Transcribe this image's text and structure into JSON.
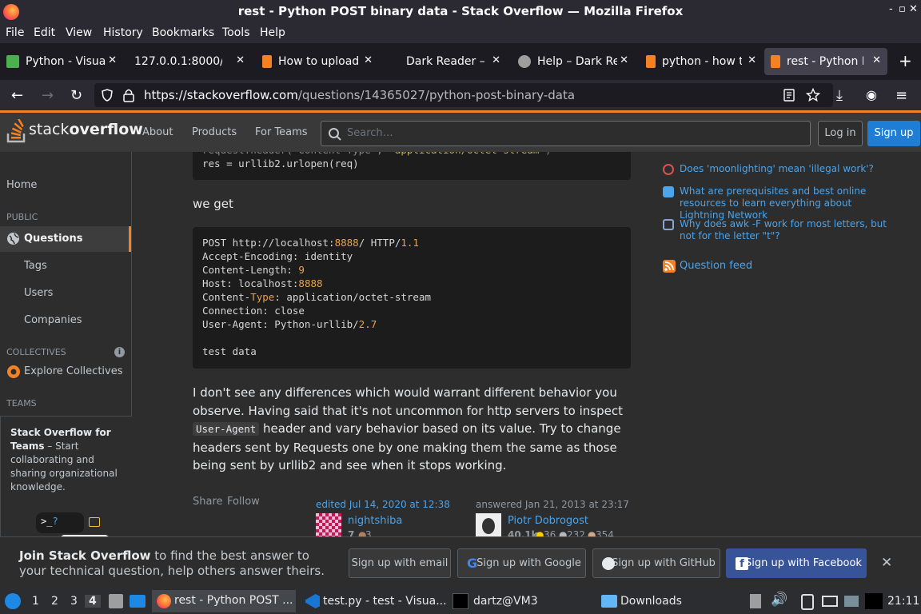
{
  "window": {
    "title": "rest - Python POST binary data - Stack Overflow — Mozilla Firefox",
    "controls": [
      "-",
      "▫",
      "✕"
    ]
  },
  "menu": [
    "File",
    "Edit",
    "View",
    "History",
    "Bookmarks",
    "Tools",
    "Help"
  ],
  "tabs": [
    {
      "label": "Python - Visual",
      "fav": "#4caf50",
      "close": "✕"
    },
    {
      "label": "127.0.0.1:8000/",
      "fav": "",
      "close": "✕"
    },
    {
      "label": "How to upload",
      "fav": "#f48225",
      "close": "✕"
    },
    {
      "label": "Dark Reader –",
      "fav": "",
      "close": "✕"
    },
    {
      "label": "Help – Dark Re",
      "fav": "#9e9e9e",
      "close": "✕"
    },
    {
      "label": "python - how t",
      "fav": "#f48225",
      "close": "✕"
    },
    {
      "label": "rest - Python P",
      "fav": "#f48225",
      "close": "✕"
    }
  ],
  "nav": {
    "url_host": "https://stackoverflow.com",
    "url_path": "/questions/14365027/python-post-binary-data"
  },
  "so": {
    "logo_a": "stack",
    "logo_b": "overflow",
    "nav": [
      "About",
      "Products",
      "For Teams"
    ],
    "search_placeholder": "Search…",
    "login": "Log in",
    "signup": "Sign up"
  },
  "leftnav": {
    "home": "Home",
    "public": "PUBLIC",
    "questions": "Questions",
    "tags": "Tags",
    "users": "Users",
    "companies": "Companies",
    "collectives": "COLLECTIVES",
    "explore": "Explore Collectives",
    "teams": "TEAMS",
    "teams_title": "Stack Overflow for Teams",
    "teams_desc": " – Start collaborating and sharing organizational knowledge."
  },
  "code1": {
    "line1": "res = urllib2.urlopen(req)"
  },
  "we_get": "we get",
  "code2": {
    "l1a": "POST http://localhost:",
    "l1b": "8888",
    "l1c": "/ HTTP/",
    "l1d": "1.1",
    "l2": "Accept-Encoding: identity",
    "l3a": "Content-Length: ",
    "l3b": "9",
    "l4a": "Host: localhost:",
    "l4b": "8888",
    "l5a": "Content-",
    "l5b": "Type",
    "l5c": ": application/octet-stream",
    "l6": "Connection: close",
    "l7a": "User-Agent: Python-urllib/",
    "l7b": "2.7",
    "l8": "test data"
  },
  "answer": {
    "p1": "I don't see any differences which would warrant different behavior you observe. Having said that it's not uncommon for http servers to inspect ",
    "code": "User-Agent",
    "p2": " header and vary behavior based on its value. Try to change headers sent by Requests one by one making them the same as those being sent by urllib2 and see when it stops working.",
    "share": "Share",
    "follow": "Follow",
    "edited": "edited Jul 14, 2020 at 12:38",
    "editor": "nightshiba",
    "editor_rep": "7",
    "editor_bronze": "3",
    "answered": "answered Jan 21, 2013 at 23:17",
    "author": "Piotr Dobrogost",
    "author_rep": "40.1k",
    "gold": "36",
    "silver": "232",
    "bronze": "354"
  },
  "hot": [
    "Does 'moonlighting' mean 'illegal work'?",
    "What are prerequisites and best online resources to learn everything about Lightning Network",
    "Why does awk -F work for most letters, but not for the letter \"t\"?"
  ],
  "feed": "Question feed",
  "banner": {
    "bold": "Join Stack Overflow",
    "rest": " to find the best answer to your technical question, help others answer theirs.",
    "email": "Sign up with email",
    "google": "Sign up with Google",
    "github": "Sign up with GitHub",
    "facebook": "Sign up with Facebook"
  },
  "taskbar": {
    "workspaces": [
      "1",
      "2",
      "3",
      "4"
    ],
    "firefox": "rest - Python POST ...",
    "vscode": "test.py - test - Visua...",
    "terminal": "dartz@VM3",
    "downloads": "Downloads",
    "clock": "21:11"
  }
}
